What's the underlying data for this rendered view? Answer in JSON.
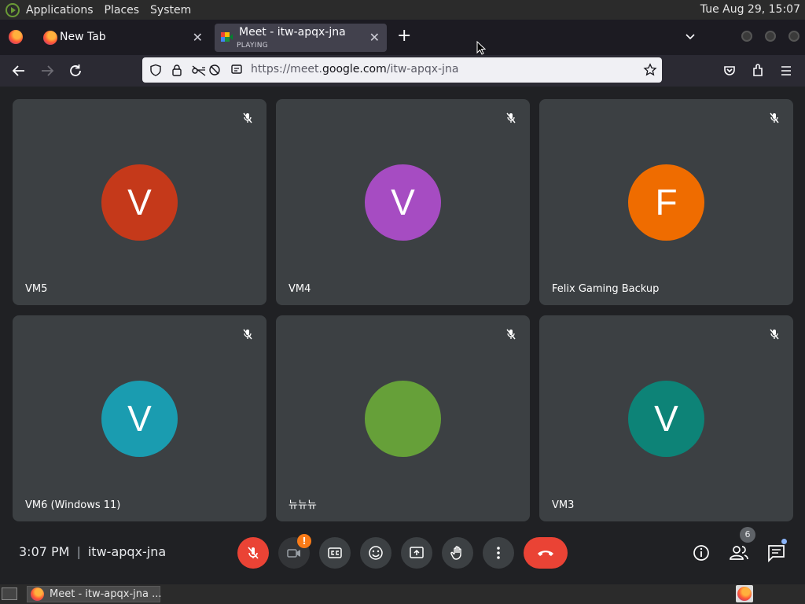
{
  "topbar": {
    "menus": [
      "Applications",
      "Places",
      "System"
    ],
    "clock": "Tue Aug 29, 15:07"
  },
  "tabs": [
    {
      "title": "New Tab",
      "subtitle": ""
    },
    {
      "title": "Meet - itw-apqx-jna",
      "subtitle": "PLAYING"
    }
  ],
  "urlbar": {
    "prefix": "https://meet.",
    "host": "google.com",
    "path": "/itw-apqx-jna"
  },
  "participants": [
    {
      "initial": "V",
      "name": "VM5",
      "color": "#c5391a"
    },
    {
      "initial": "V",
      "name": "VM4",
      "color": "#a64cc2"
    },
    {
      "initial": "F",
      "name": "Felix Gaming Backup",
      "color": "#ef6c00"
    },
    {
      "initial": "V",
      "name": "VM6 (Windows 11)",
      "color": "#1a9cb0"
    },
    {
      "initial": "",
      "name": "뉴뉴뉴",
      "color": "#66a039"
    },
    {
      "initial": "V",
      "name": "VM3",
      "color": "#0d8377"
    }
  ],
  "meeting": {
    "time": "3:07 PM",
    "code": "itw-apqx-jna",
    "people_count": "6",
    "camera_warning": "!"
  },
  "taskbar": {
    "item_label": "Meet - itw-apqx-jna ..."
  },
  "colors": {
    "leave": "#ea4335",
    "mic_off": "#ea4335",
    "tile_bg": "#3c4043",
    "stage_bg": "#202124"
  }
}
